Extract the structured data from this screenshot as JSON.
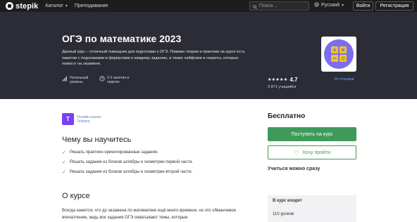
{
  "nav": {
    "logo_text": "stepik",
    "catalog_label": "Каталог",
    "teaching_label": "Преподавание",
    "search_placeholder": "Поиск...",
    "language_label": "Русский",
    "login_label": "Войти",
    "register_label": "Регистрация"
  },
  "hero": {
    "title": "ОГЭ по математике 2023",
    "description": "Данный курс – отличный помощник для подготовки к ОГЭ. Помимо теории и практики на курсе есть памятки с подсказками и формулами к каждому заданию, а также лайфхаки и секреты, которые помогут на экзамене.",
    "level_line1": "Начальный",
    "level_line2": "уровень",
    "time_line1": "2-3 занятия в",
    "time_line2": "неделю",
    "stars": "★★★★★",
    "rating": "4.7",
    "learners": "3 871 учащийся",
    "reviews": "14 отзывов",
    "cover_colors": {
      "background": "#7c6cf0",
      "tile": "#f5c518"
    }
  },
  "author": {
    "logo_letter": "Т",
    "name_line1": "Онлайн-школа",
    "name_line2": "Тетрика"
  },
  "learn": {
    "heading": "Чему вы научитесь",
    "items": [
      "Решать практико-ориентированные задания.",
      "Решать задания из блоков алгебры и геометрии первой части.",
      "Решать задания из блоков алгебры и геометрии второй части."
    ]
  },
  "about": {
    "heading": "О курсе",
    "text": "Всегда кажется, что до экзамена по математике ещё много времени, но это обманчивое впечатление, ведь все задания ОГЭ охватывают темы, которые"
  },
  "sidebar": {
    "price": "Бесплатно",
    "enroll_label": "Поступить на курс",
    "wishlist_label": "Хочу пройти",
    "learn_now": "Учиться можно сразу",
    "includes_title": "В курс входят",
    "lessons": "110 уроков"
  },
  "colors": {
    "accent_green": "#3f9a5a",
    "hero_bg": "#2c2c36",
    "link_blue": "#5fa8ff"
  }
}
